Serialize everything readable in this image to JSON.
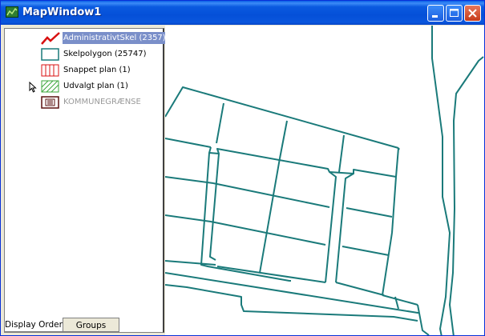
{
  "window": {
    "title": "MapWindow1",
    "controls": [
      "minimize",
      "maximize",
      "close"
    ]
  },
  "legend": {
    "layers": [
      {
        "label": "AdministrativtSkel (2357)",
        "icon": "line-icon",
        "selected": true
      },
      {
        "label": "Skelpolygon (25747)",
        "icon": "polygon-icon"
      },
      {
        "label": "Snappet plan (1)",
        "icon": "red-hatch-icon"
      },
      {
        "label": "Udvalgt plan (1)",
        "icon": "green-hatch-icon"
      },
      {
        "label": "KOMMUNEGRÆNSE",
        "icon": "boundary-icon",
        "dimmed": true
      }
    ]
  },
  "tabs": {
    "display_order": "Display Order",
    "groups": "Groups"
  },
  "colors": {
    "map_line": "#1A7A7A",
    "title_bar": "#0A5AE0",
    "selection": "#7A8FC9"
  }
}
